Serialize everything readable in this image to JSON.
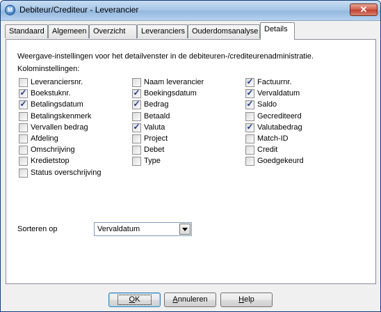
{
  "window": {
    "title": "Debiteur/Crediteur - Leverancier",
    "close_symbol": "✕"
  },
  "tabs": [
    {
      "label": "Standaard",
      "active": false
    },
    {
      "label": "Algemeen",
      "active": false
    },
    {
      "label": "Overzicht",
      "active": false
    },
    {
      "label": "Leveranciers",
      "active": false
    },
    {
      "label": "Ouderdomsanalyse",
      "active": false
    },
    {
      "label": "Details",
      "active": true
    }
  ],
  "details": {
    "description": "Weergave-instellingen voor het detailvenster in de debiteuren-/crediteurenadministratie.",
    "columns_label": "Kolominstellingen:",
    "columns": [
      [
        {
          "label": "Leveranciersnr.",
          "checked": false
        },
        {
          "label": "Boekstuknr.",
          "checked": true
        },
        {
          "label": "Betalingsdatum",
          "checked": true
        },
        {
          "label": "Betalingskenmerk",
          "checked": false
        },
        {
          "label": "Vervallen bedrag",
          "checked": false
        },
        {
          "label": "Afdeling",
          "checked": false
        },
        {
          "label": "Omschrijving",
          "checked": false
        },
        {
          "label": "Kredietstop",
          "checked": false
        },
        {
          "label": "Status overschrijving",
          "checked": false
        }
      ],
      [
        {
          "label": "Naam leverancier",
          "checked": false
        },
        {
          "label": "Boekingsdatum",
          "checked": true
        },
        {
          "label": "Bedrag",
          "checked": true
        },
        {
          "label": "Betaald",
          "checked": false
        },
        {
          "label": "Valuta",
          "checked": true
        },
        {
          "label": "Project",
          "checked": false
        },
        {
          "label": "Debet",
          "checked": false
        },
        {
          "label": "Type",
          "checked": false
        }
      ],
      [
        {
          "label": "Factuurnr.",
          "checked": true
        },
        {
          "label": "Vervaldatum",
          "checked": true
        },
        {
          "label": "Saldo",
          "checked": true
        },
        {
          "label": "Gecrediteerd",
          "checked": false
        },
        {
          "label": "Valutabedrag",
          "checked": true
        },
        {
          "label": "Match-ID",
          "checked": false
        },
        {
          "label": "Credit",
          "checked": false
        },
        {
          "label": "Goedgekeurd",
          "checked": false
        }
      ]
    ],
    "sort_label": "Sorteren op",
    "sort_value": "Vervaldatum"
  },
  "buttons": {
    "ok": {
      "label": "OK",
      "accel": "O",
      "rest": "K"
    },
    "cancel": {
      "label": "Annuleren",
      "accel": "A",
      "rest": "nnuleren"
    },
    "help": {
      "label": "Help",
      "accel": "H",
      "rest": "elp"
    }
  },
  "check_symbol": "✓"
}
